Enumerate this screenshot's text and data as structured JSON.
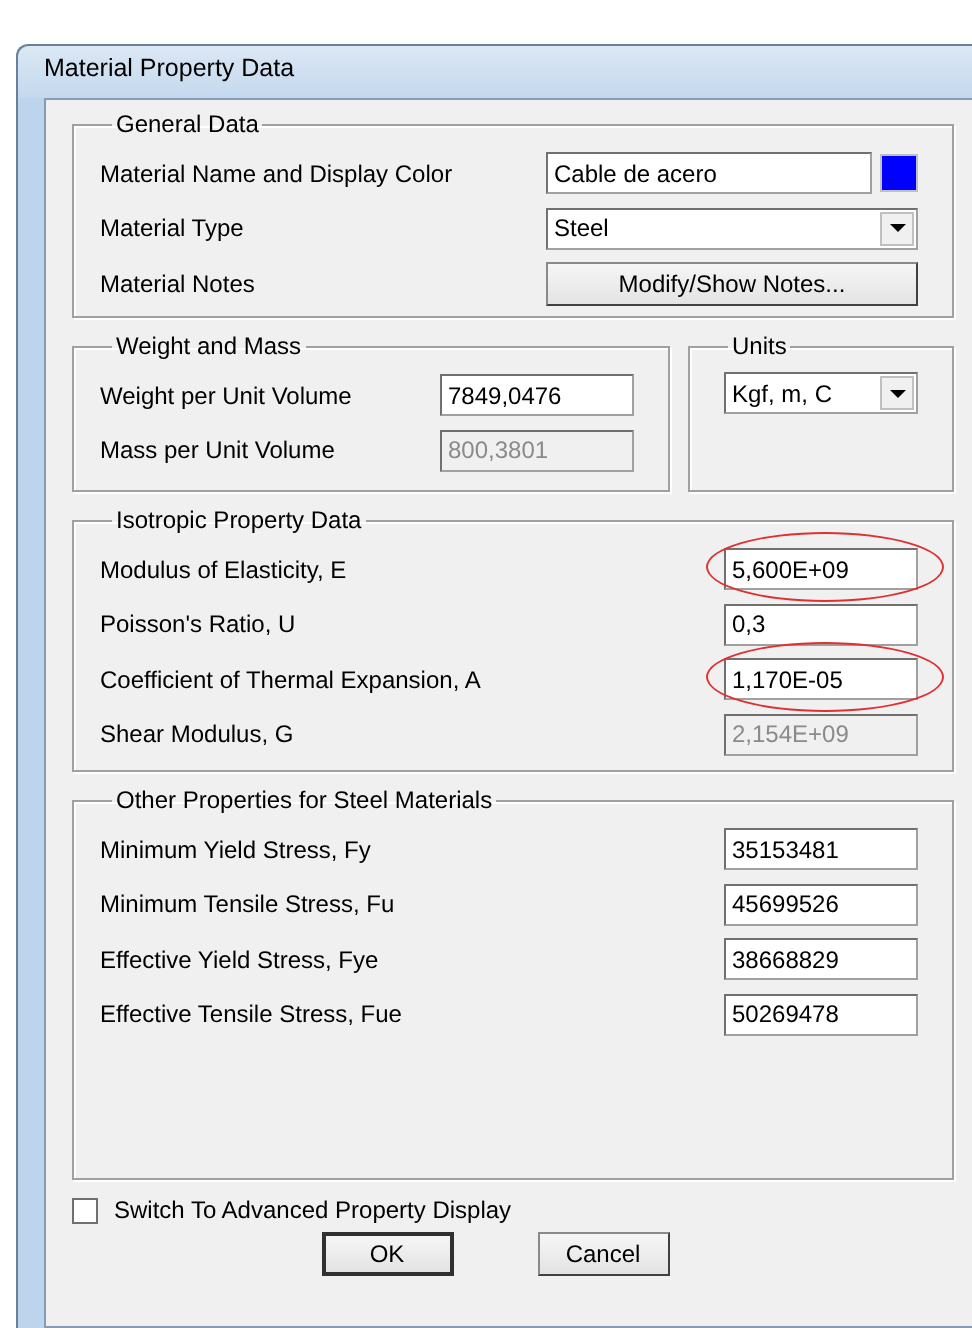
{
  "window": {
    "title": "Material Property Data"
  },
  "general": {
    "title": "General Data",
    "rows": [
      {
        "kind": "text",
        "label": "Material Name and Display Color",
        "value": "Cable de acero",
        "color": "#0000ff"
      },
      {
        "kind": "dropdown",
        "label": "Material Type",
        "value": "Steel"
      },
      {
        "kind": "button",
        "label": "Material Notes",
        "value": "Modify/Show Notes..."
      }
    ]
  },
  "weight": {
    "title": "Weight and Mass",
    "rows": [
      {
        "label": "Weight per Unit Volume",
        "value": "7849,0476",
        "disabled": false
      },
      {
        "label": "Mass per Unit Volume",
        "value": "800,3801",
        "disabled": true
      }
    ]
  },
  "units": {
    "title": "Units",
    "value": "Kgf, m, C"
  },
  "isotropic": {
    "title": "Isotropic Property Data",
    "rows": [
      {
        "label": "Modulus of Elasticity,  E",
        "value": "5,600E+09",
        "disabled": false,
        "circled": true
      },
      {
        "label": "Poisson's Ratio,  U",
        "value": "0,3",
        "disabled": false,
        "circled": false
      },
      {
        "label": "Coefficient of Thermal Expansion,  A",
        "value": "1,170E-05",
        "disabled": false,
        "circled": true
      },
      {
        "label": "Shear Modulus,  G",
        "value": "2,154E+09",
        "disabled": true,
        "circled": false
      }
    ]
  },
  "steel": {
    "title": "Other Properties for Steel Materials",
    "rows": [
      {
        "label": "Minimum Yield Stress, Fy",
        "value": "35153481"
      },
      {
        "label": "Minimum Tensile Stress, Fu",
        "value": "45699526"
      },
      {
        "label": "Effective Yield Stress, Fye",
        "value": "38668829"
      },
      {
        "label": "Effective Tensile Stress, Fue",
        "value": "50269478"
      }
    ]
  },
  "advanced": {
    "label": "Switch To Advanced Property Display",
    "checked": false
  },
  "buttons": [
    {
      "label": "OK",
      "default": true
    },
    {
      "label": "Cancel",
      "default": false
    }
  ]
}
